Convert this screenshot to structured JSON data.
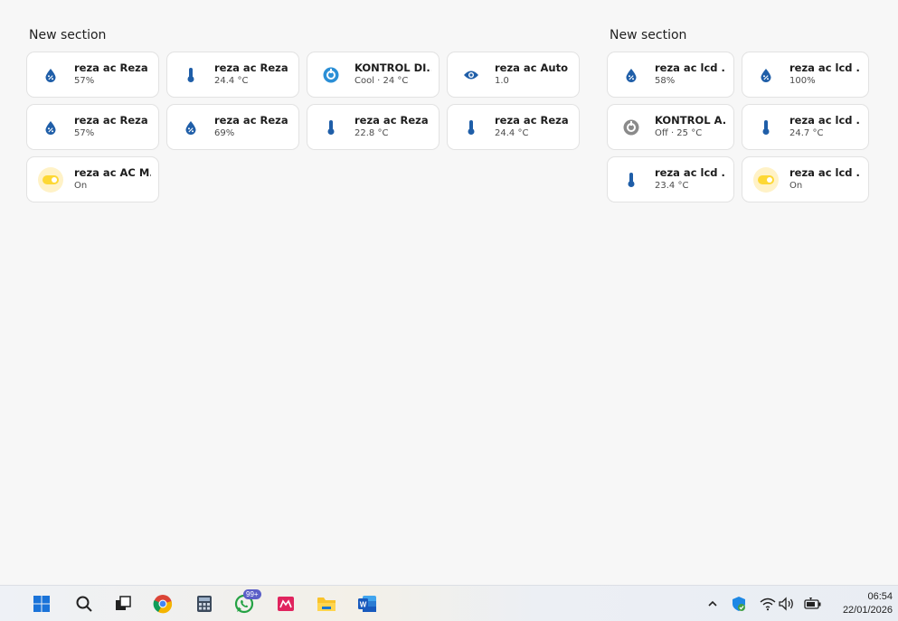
{
  "sections": [
    {
      "title": "New section",
      "cards": [
        {
          "icon": "water-percent-icon",
          "name": "reza ac Reza ...",
          "state": "57%"
        },
        {
          "icon": "thermometer-icon",
          "name": "reza ac Reza ...",
          "state": "24.4 °C"
        },
        {
          "icon": "thermostat-dial-active-icon",
          "name": "KONTROL DI...",
          "state": "Cool · 24 °C"
        },
        {
          "icon": "eye-icon",
          "name": "reza ac Auto ...",
          "state": "1.0"
        },
        {
          "icon": "water-percent-icon",
          "name": "reza ac Reza ...",
          "state": "57%"
        },
        {
          "icon": "water-percent-icon",
          "name": "reza ac Reza ...",
          "state": "69%"
        },
        {
          "icon": "thermometer-icon",
          "name": "reza ac Reza ...",
          "state": "22.8 °C"
        },
        {
          "icon": "thermometer-icon",
          "name": "reza ac Reza ...",
          "state": "24.4 °C"
        },
        {
          "icon": "toggle-switch-on-icon",
          "name": "reza ac AC M...",
          "state": "On"
        }
      ]
    },
    {
      "title": "New section",
      "cards": [
        {
          "icon": "water-percent-icon",
          "name": "reza ac lcd ...",
          "state": "58%"
        },
        {
          "icon": "water-percent-icon",
          "name": "reza ac lcd ...",
          "state": "100%"
        },
        {
          "icon": "thermostat-dial-off-icon",
          "name": "KONTROL A...",
          "state": "Off · 25 °C"
        },
        {
          "icon": "thermometer-icon",
          "name": "reza ac lcd ...",
          "state": "24.7 °C"
        },
        {
          "icon": "thermometer-icon",
          "name": "reza ac lcd ...",
          "state": "23.4 °C"
        },
        {
          "icon": "toggle-switch-on-icon",
          "name": "reza ac lcd ...",
          "state": "On"
        }
      ]
    }
  ],
  "colors": {
    "icon_blue": "#1f5ea8",
    "thermostat_active": "#2b8fd6",
    "thermostat_off": "#8a8a8a",
    "toggle_on": "#fdd835",
    "toggle_bg": "#fff2c7"
  },
  "taskbar": {
    "apps": [
      {
        "icon": "windows-start-icon"
      },
      {
        "icon": "search-icon"
      },
      {
        "icon": "task-view-icon"
      },
      {
        "icon": "chrome-icon"
      },
      {
        "icon": "calculator-icon"
      },
      {
        "icon": "whatsapp-icon",
        "badge": "99+"
      },
      {
        "icon": "app-red-icon"
      },
      {
        "icon": "file-explorer-icon"
      },
      {
        "icon": "word-icon"
      }
    ],
    "tray": [
      {
        "icon": "chevron-up-icon"
      },
      {
        "icon": "security-shield-icon"
      },
      {
        "icon": "wifi-icon"
      },
      {
        "icon": "volume-icon"
      },
      {
        "icon": "battery-icon"
      }
    ],
    "time": "06:54",
    "date": "22/01/2026"
  }
}
